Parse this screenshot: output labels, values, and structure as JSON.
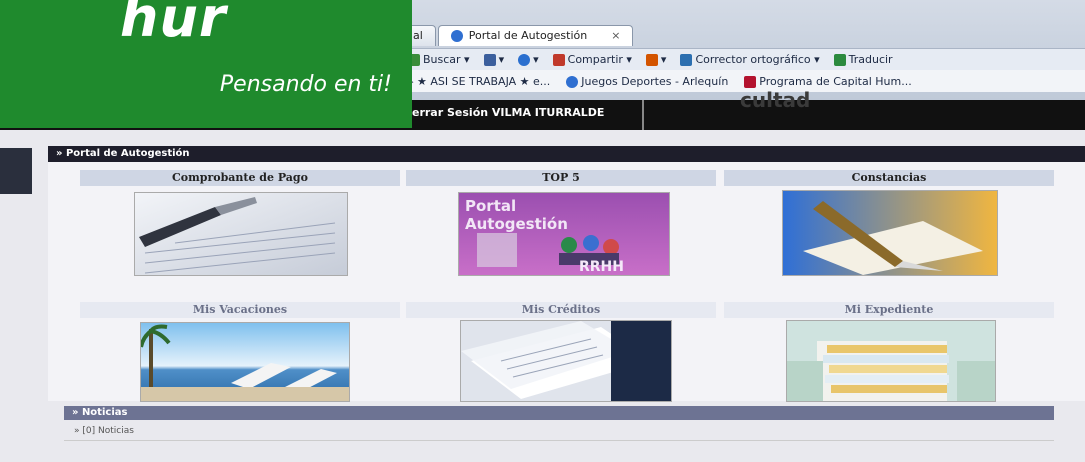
{
  "logo": {
    "brand": "hur",
    "tagline": "Pensando en ti!"
  },
  "browser": {
    "tabs": [
      {
        "label": "al"
      },
      {
        "label": "Portal de Autogestión",
        "close": "×"
      }
    ],
    "command_bar": [
      "Buscar ▾",
      "▾",
      "▾",
      "Compartir ▾",
      "▾",
      "Corrector ortográfico ▾",
      "Traducir"
    ],
    "favorites": [
      "▸ ★ ASI SE TRABAJA ★ e...",
      "Juegos Deportes - Arlequín",
      "Programa de Capital Hum..."
    ]
  },
  "site_header": {
    "session": "errar Sesión VILMA ITURRALDE",
    "ghost": "cultad"
  },
  "portal": {
    "title": "» Portal de Autogestión",
    "items": [
      {
        "label": "Comprobante de Pago"
      },
      {
        "label": "TOP 5"
      },
      {
        "label": "Constancias"
      },
      {
        "label": "Mis Vacaciones"
      },
      {
        "label": "Mis Créditos"
      },
      {
        "label": "Mi Expediente"
      }
    ],
    "top5_image_text": [
      "Portal",
      "Autogestión",
      "RRHH"
    ]
  },
  "news": {
    "title": "» Noticias",
    "item": "» [0] Noticias"
  },
  "colors": {
    "brand_green": "#1f8a2d",
    "header_dark": "#111111",
    "panel_title": "#cfd6e4"
  }
}
